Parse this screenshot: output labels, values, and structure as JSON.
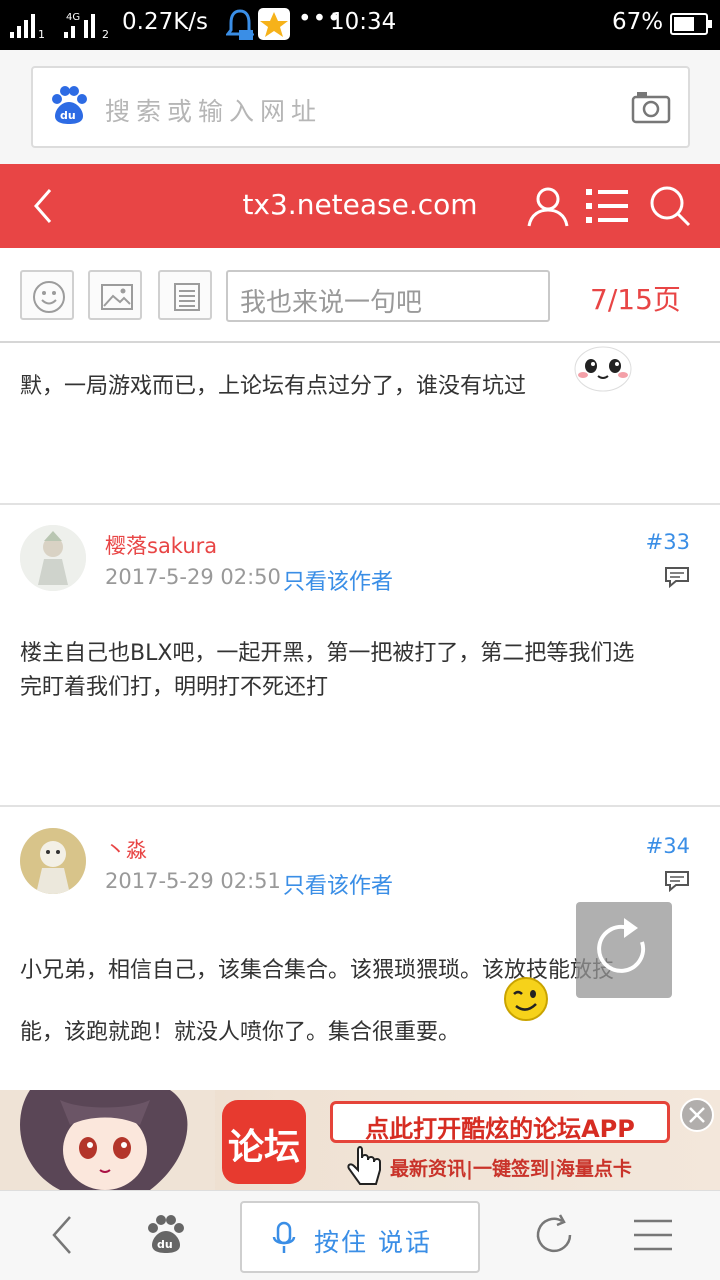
{
  "status_bar": {
    "network_speed": "0.27K/s",
    "time": "10:34",
    "battery_percent": "67%",
    "battery_level": 0.67,
    "network_type": "4G"
  },
  "search": {
    "placeholder": "搜索或输入网址"
  },
  "header": {
    "domain": "tx3.netease.com"
  },
  "toolbar": {
    "comment_placeholder": "我也来说一句吧",
    "page_indicator": "7/15页"
  },
  "posts": [
    {
      "text": "默，一局游戏而已，上论坛有点过分了，谁没有坑过"
    },
    {
      "username": "樱落sakura",
      "date": "2017-5-29 02:50",
      "only_author": "只看该作者",
      "floor": "#33",
      "text_line1": "楼主自己也BLX吧，一起开黑，第一把被打了，第二把等我们选",
      "text_line2": "完盯着我们打，明明打不死还打"
    },
    {
      "username": "丶淼",
      "date": "2017-5-29 02:51",
      "only_author": "只看该作者",
      "floor": "#34",
      "text_line1": "小兄弟，相信自己，该集合集合。该猥琐猥琐。该放技能放技",
      "text_line2": "能，该跑就跑！就没人喷你了。集合很重要。"
    }
  ],
  "ad": {
    "logo_text": "论坛",
    "cta": "点此打开酷炫的论坛APP",
    "subtitle": "最新资讯|一键签到|海量点卡"
  },
  "bottom_bar": {
    "voice_label": "按住 说话"
  },
  "colors": {
    "header_red": "#e84545",
    "link_blue": "#3a8ee6"
  }
}
